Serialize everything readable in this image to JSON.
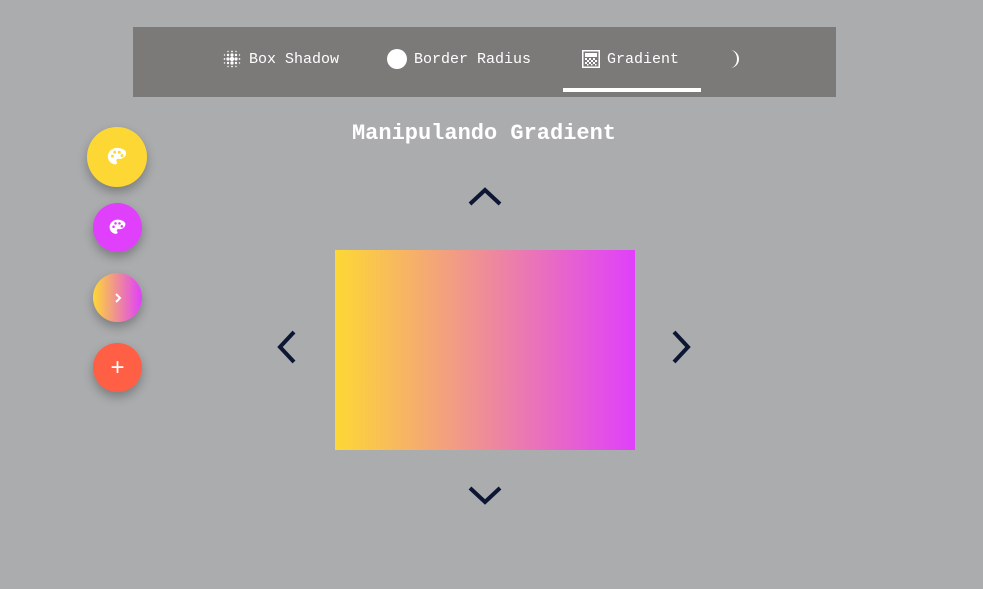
{
  "navbar": {
    "tabs": [
      {
        "label": "Box Shadow",
        "icon": "box-shadow-icon"
      },
      {
        "label": "Border Radius",
        "icon": "circle-icon"
      },
      {
        "label": "Gradient",
        "icon": "gradient-icon",
        "active": true
      }
    ],
    "theme_toggle_icon": "half-moon-icon"
  },
  "page": {
    "title": "Manipulando Gradient"
  },
  "fab_menu": {
    "main_icon": "palette-icon",
    "secondary_icon": "palette-icon",
    "gradient_icon": "chevron-right-icon",
    "add_label": "+"
  },
  "gradient": {
    "direction": "to right",
    "start_color": "#fdd835",
    "end_color": "#e040fb"
  },
  "colors": {
    "background": "#abacae",
    "navbar": "#7c7979",
    "fab_main": "#fdd835",
    "fab_secondary": "#e040fb",
    "fab_add": "#ff5f45",
    "arrow": "#0d1633"
  }
}
